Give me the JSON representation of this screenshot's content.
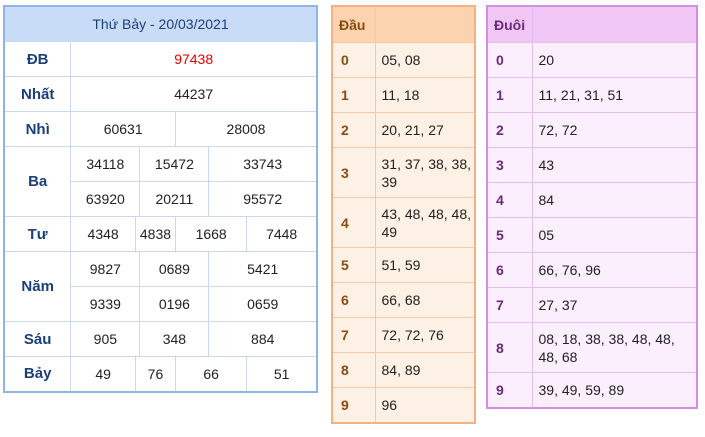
{
  "results": {
    "title": "Thứ Bảy - 20/03/2021",
    "rows": {
      "db": {
        "label": "ĐB",
        "values": [
          "97438"
        ]
      },
      "nhat": {
        "label": "Nhất",
        "values": [
          "44237"
        ]
      },
      "nhi": {
        "label": "Nhì",
        "values": [
          "60631",
          "28008"
        ]
      },
      "ba": {
        "label": "Ba",
        "values": [
          "34118",
          "15472",
          "33743",
          "63920",
          "20211",
          "95572"
        ]
      },
      "tu": {
        "label": "Tư",
        "values": [
          "4348",
          "4838",
          "1668",
          "7448"
        ]
      },
      "nam": {
        "label": "Năm",
        "values": [
          "9827",
          "0689",
          "5421",
          "9339",
          "0196",
          "0659"
        ]
      },
      "sau": {
        "label": "Sáu",
        "values": [
          "905",
          "348",
          "884"
        ]
      },
      "bay": {
        "label": "Bảy",
        "values": [
          "49",
          "76",
          "66",
          "51"
        ]
      }
    },
    "special_color": "#e60000"
  },
  "dau": {
    "header": "Đầu",
    "rows": [
      {
        "num": "0",
        "values": "05, 08"
      },
      {
        "num": "1",
        "values": "11, 18"
      },
      {
        "num": "2",
        "values": "20, 21, 27"
      },
      {
        "num": "3",
        "values": "31, 37, 38, 38, 39"
      },
      {
        "num": "4",
        "values": "43, 48, 48, 48, 49"
      },
      {
        "num": "5",
        "values": "51, 59"
      },
      {
        "num": "6",
        "values": "66, 68"
      },
      {
        "num": "7",
        "values": "72, 72, 76"
      },
      {
        "num": "8",
        "values": "84, 89"
      },
      {
        "num": "9",
        "values": "96"
      }
    ]
  },
  "duoi": {
    "header": "Đuôi",
    "rows": [
      {
        "num": "0",
        "values": "20"
      },
      {
        "num": "1",
        "values": "11, 21, 31, 51"
      },
      {
        "num": "2",
        "values": "72, 72"
      },
      {
        "num": "3",
        "values": "43"
      },
      {
        "num": "4",
        "values": "84"
      },
      {
        "num": "5",
        "values": "05"
      },
      {
        "num": "6",
        "values": "66, 76, 96"
      },
      {
        "num": "7",
        "values": "27, 37"
      },
      {
        "num": "8",
        "values": "08, 18, 38, 38, 48, 48, 48, 68"
      },
      {
        "num": "9",
        "values": "39, 49, 59, 89"
      }
    ]
  },
  "colors": {
    "results_header_bg": "#c8dcf7",
    "results_border": "#8fb4e6",
    "dau_bg": "#fdf0e4",
    "dau_border": "#f4b183",
    "duoi_bg": "#fbeefd",
    "duoi_border": "#d58fe0"
  }
}
